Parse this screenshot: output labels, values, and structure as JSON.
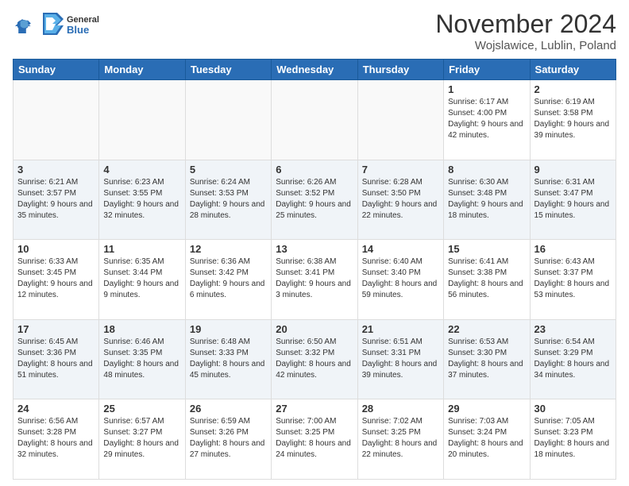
{
  "logo": {
    "general": "General",
    "blue": "Blue"
  },
  "title": "November 2024",
  "subtitle": "Wojslawice, Lublin, Poland",
  "headers": [
    "Sunday",
    "Monday",
    "Tuesday",
    "Wednesday",
    "Thursday",
    "Friday",
    "Saturday"
  ],
  "weeks": [
    {
      "days": [
        {
          "num": "",
          "info": "",
          "empty": true
        },
        {
          "num": "",
          "info": "",
          "empty": true
        },
        {
          "num": "",
          "info": "",
          "empty": true
        },
        {
          "num": "",
          "info": "",
          "empty": true
        },
        {
          "num": "",
          "info": "",
          "empty": true
        },
        {
          "num": "1",
          "info": "Sunrise: 6:17 AM\nSunset: 4:00 PM\nDaylight: 9 hours and 42 minutes.",
          "empty": false
        },
        {
          "num": "2",
          "info": "Sunrise: 6:19 AM\nSunset: 3:58 PM\nDaylight: 9 hours and 39 minutes.",
          "empty": false
        }
      ]
    },
    {
      "days": [
        {
          "num": "3",
          "info": "Sunrise: 6:21 AM\nSunset: 3:57 PM\nDaylight: 9 hours and 35 minutes.",
          "empty": false
        },
        {
          "num": "4",
          "info": "Sunrise: 6:23 AM\nSunset: 3:55 PM\nDaylight: 9 hours and 32 minutes.",
          "empty": false
        },
        {
          "num": "5",
          "info": "Sunrise: 6:24 AM\nSunset: 3:53 PM\nDaylight: 9 hours and 28 minutes.",
          "empty": false
        },
        {
          "num": "6",
          "info": "Sunrise: 6:26 AM\nSunset: 3:52 PM\nDaylight: 9 hours and 25 minutes.",
          "empty": false
        },
        {
          "num": "7",
          "info": "Sunrise: 6:28 AM\nSunset: 3:50 PM\nDaylight: 9 hours and 22 minutes.",
          "empty": false
        },
        {
          "num": "8",
          "info": "Sunrise: 6:30 AM\nSunset: 3:48 PM\nDaylight: 9 hours and 18 minutes.",
          "empty": false
        },
        {
          "num": "9",
          "info": "Sunrise: 6:31 AM\nSunset: 3:47 PM\nDaylight: 9 hours and 15 minutes.",
          "empty": false
        }
      ]
    },
    {
      "days": [
        {
          "num": "10",
          "info": "Sunrise: 6:33 AM\nSunset: 3:45 PM\nDaylight: 9 hours and 12 minutes.",
          "empty": false
        },
        {
          "num": "11",
          "info": "Sunrise: 6:35 AM\nSunset: 3:44 PM\nDaylight: 9 hours and 9 minutes.",
          "empty": false
        },
        {
          "num": "12",
          "info": "Sunrise: 6:36 AM\nSunset: 3:42 PM\nDaylight: 9 hours and 6 minutes.",
          "empty": false
        },
        {
          "num": "13",
          "info": "Sunrise: 6:38 AM\nSunset: 3:41 PM\nDaylight: 9 hours and 3 minutes.",
          "empty": false
        },
        {
          "num": "14",
          "info": "Sunrise: 6:40 AM\nSunset: 3:40 PM\nDaylight: 8 hours and 59 minutes.",
          "empty": false
        },
        {
          "num": "15",
          "info": "Sunrise: 6:41 AM\nSunset: 3:38 PM\nDaylight: 8 hours and 56 minutes.",
          "empty": false
        },
        {
          "num": "16",
          "info": "Sunrise: 6:43 AM\nSunset: 3:37 PM\nDaylight: 8 hours and 53 minutes.",
          "empty": false
        }
      ]
    },
    {
      "days": [
        {
          "num": "17",
          "info": "Sunrise: 6:45 AM\nSunset: 3:36 PM\nDaylight: 8 hours and 51 minutes.",
          "empty": false
        },
        {
          "num": "18",
          "info": "Sunrise: 6:46 AM\nSunset: 3:35 PM\nDaylight: 8 hours and 48 minutes.",
          "empty": false
        },
        {
          "num": "19",
          "info": "Sunrise: 6:48 AM\nSunset: 3:33 PM\nDaylight: 8 hours and 45 minutes.",
          "empty": false
        },
        {
          "num": "20",
          "info": "Sunrise: 6:50 AM\nSunset: 3:32 PM\nDaylight: 8 hours and 42 minutes.",
          "empty": false
        },
        {
          "num": "21",
          "info": "Sunrise: 6:51 AM\nSunset: 3:31 PM\nDaylight: 8 hours and 39 minutes.",
          "empty": false
        },
        {
          "num": "22",
          "info": "Sunrise: 6:53 AM\nSunset: 3:30 PM\nDaylight: 8 hours and 37 minutes.",
          "empty": false
        },
        {
          "num": "23",
          "info": "Sunrise: 6:54 AM\nSunset: 3:29 PM\nDaylight: 8 hours and 34 minutes.",
          "empty": false
        }
      ]
    },
    {
      "days": [
        {
          "num": "24",
          "info": "Sunrise: 6:56 AM\nSunset: 3:28 PM\nDaylight: 8 hours and 32 minutes.",
          "empty": false
        },
        {
          "num": "25",
          "info": "Sunrise: 6:57 AM\nSunset: 3:27 PM\nDaylight: 8 hours and 29 minutes.",
          "empty": false
        },
        {
          "num": "26",
          "info": "Sunrise: 6:59 AM\nSunset: 3:26 PM\nDaylight: 8 hours and 27 minutes.",
          "empty": false
        },
        {
          "num": "27",
          "info": "Sunrise: 7:00 AM\nSunset: 3:25 PM\nDaylight: 8 hours and 24 minutes.",
          "empty": false
        },
        {
          "num": "28",
          "info": "Sunrise: 7:02 AM\nSunset: 3:25 PM\nDaylight: 8 hours and 22 minutes.",
          "empty": false
        },
        {
          "num": "29",
          "info": "Sunrise: 7:03 AM\nSunset: 3:24 PM\nDaylight: 8 hours and 20 minutes.",
          "empty": false
        },
        {
          "num": "30",
          "info": "Sunrise: 7:05 AM\nSunset: 3:23 PM\nDaylight: 8 hours and 18 minutes.",
          "empty": false
        }
      ]
    }
  ]
}
